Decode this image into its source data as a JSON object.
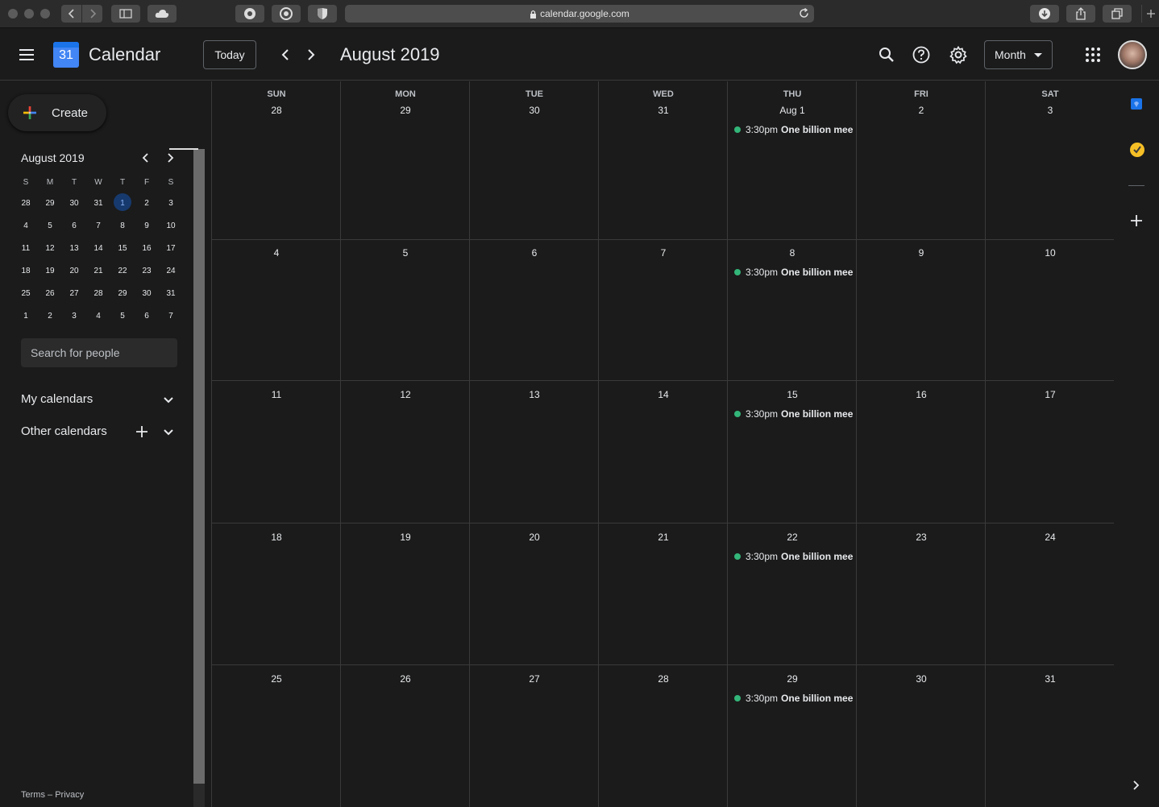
{
  "browser": {
    "url": "calendar.google.com"
  },
  "header": {
    "app_title": "Calendar",
    "logo_day": "31",
    "today_label": "Today",
    "period_title": "August 2019",
    "view_label": "Month"
  },
  "sidebar": {
    "create_label": "Create",
    "mini_title": "August 2019",
    "mini_weekdays": [
      "S",
      "M",
      "T",
      "W",
      "T",
      "F",
      "S"
    ],
    "mini_weeks": [
      [
        "28",
        "29",
        "30",
        "31",
        "1",
        "2",
        "3"
      ],
      [
        "4",
        "5",
        "6",
        "7",
        "8",
        "9",
        "10"
      ],
      [
        "11",
        "12",
        "13",
        "14",
        "15",
        "16",
        "17"
      ],
      [
        "18",
        "19",
        "20",
        "21",
        "22",
        "23",
        "24"
      ],
      [
        "25",
        "26",
        "27",
        "28",
        "29",
        "30",
        "31"
      ],
      [
        "1",
        "2",
        "3",
        "4",
        "5",
        "6",
        "7"
      ]
    ],
    "mini_selected": "1",
    "people_placeholder": "Search for people",
    "my_calendars": "My calendars",
    "other_calendars": "Other calendars",
    "footer_terms": "Terms",
    "footer_sep": "–",
    "footer_privacy": "Privacy"
  },
  "month": {
    "weekday_headers": [
      "SUN",
      "MON",
      "TUE",
      "WED",
      "THU",
      "FRI",
      "SAT"
    ],
    "weeks": [
      [
        "28",
        "29",
        "30",
        "31",
        "Aug 1",
        "2",
        "3"
      ],
      [
        "4",
        "5",
        "6",
        "7",
        "8",
        "9",
        "10"
      ],
      [
        "11",
        "12",
        "13",
        "14",
        "15",
        "16",
        "17"
      ],
      [
        "18",
        "19",
        "20",
        "21",
        "22",
        "23",
        "24"
      ],
      [
        "25",
        "26",
        "27",
        "28",
        "29",
        "30",
        "31"
      ]
    ],
    "event": {
      "day_column": 4,
      "time": "3:30pm",
      "title": "One billion mee",
      "color": "#33b679"
    }
  },
  "colors": {
    "background": "#1b1b1b",
    "accent": "#8ab4f8",
    "event": "#33b679"
  }
}
